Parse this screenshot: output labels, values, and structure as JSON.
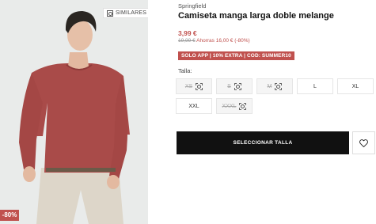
{
  "product": {
    "brand": "Springfield",
    "title": "Camiseta manga larga doble melange",
    "price": "3,99 €",
    "old_price": "19,99 €",
    "saving": "Ahorras 16,00 € (-80%)",
    "promo": "SOLO APP | 10% EXTRA | COD: SUMMER10",
    "discount_badge": "-80%",
    "similares_label": "SIMILARES"
  },
  "sizes": {
    "label": "Talla:",
    "items": [
      {
        "label": "XS",
        "available": false
      },
      {
        "label": "S",
        "available": false
      },
      {
        "label": "M",
        "available": false
      },
      {
        "label": "L",
        "available": true
      },
      {
        "label": "XL",
        "available": true
      },
      {
        "label": "XXL",
        "available": true
      },
      {
        "label": "XXXL",
        "available": false
      }
    ]
  },
  "actions": {
    "select_size": "SELECCIONAR TALLA",
    "wishlist_icon": "heart-icon"
  },
  "colors": {
    "accent": "#c0514e",
    "shirt": "#a94b49",
    "cta": "#111111"
  }
}
